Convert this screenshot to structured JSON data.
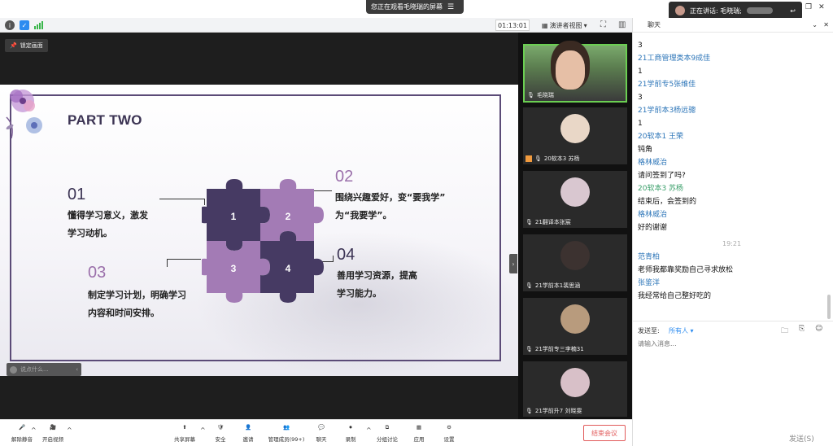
{
  "share_banner": {
    "text": "您正在观看毛晓瑞的屏幕"
  },
  "toolbar": {
    "timer": "01:13:01",
    "view_mode": "演讲者视图"
  },
  "share_area": {
    "lock_label": "锁定画面",
    "say_placeholder": "说点什么..."
  },
  "slide": {
    "title": "PART TWO",
    "items": [
      {
        "num": "01",
        "line1": "懂得学习意义，激发",
        "line2": "学习动机。"
      },
      {
        "num": "02",
        "line1": "围绕兴趣爱好，变“要我学”",
        "line2": "为“我要学”。"
      },
      {
        "num": "03",
        "line1": "制定学习计划，明确学习",
        "line2": "内容和时间安排。"
      },
      {
        "num": "04",
        "line1": "善用学习资源，提高",
        "line2": "学习能力。"
      }
    ],
    "puzzle_labels": [
      "1",
      "2",
      "3",
      "4"
    ],
    "colors": {
      "dark": "#463a63",
      "light": "#a37bb5",
      "frame": "#5b4b77"
    }
  },
  "video_tiles": [
    {
      "name": "毛晓瑞"
    },
    {
      "name": "20软本3 苏杨"
    },
    {
      "name": "21翻译本张宸"
    },
    {
      "name": "21学前本1裴思涵"
    },
    {
      "name": "21学前专三李楠31"
    },
    {
      "name": "21学前升7 刘晓雯"
    }
  ],
  "speaking": {
    "label": "正在讲话: 毛晓瑞;"
  },
  "chat": {
    "title": "聊天",
    "messages": [
      {
        "type": "body",
        "text": "3"
      },
      {
        "type": "sender",
        "text": "21工商管理类本9成佳"
      },
      {
        "type": "body",
        "text": "1"
      },
      {
        "type": "sender",
        "text": "21学前专5张维佳"
      },
      {
        "type": "body",
        "text": "3"
      },
      {
        "type": "sender",
        "text": "21学前本3杨远骢"
      },
      {
        "type": "body",
        "text": "1"
      },
      {
        "type": "sender",
        "text": "20软本1 王荣"
      },
      {
        "type": "body",
        "text": "钝角"
      },
      {
        "type": "sender",
        "text": "格林威治"
      },
      {
        "type": "body",
        "text": "请问签到了吗?"
      },
      {
        "type": "sender-green",
        "text": "20软本3  苏杨"
      },
      {
        "type": "body",
        "text": "结束后，会签到的"
      },
      {
        "type": "sender",
        "text": "格林威治"
      },
      {
        "type": "body",
        "text": "好的谢谢"
      },
      {
        "type": "time",
        "text": "19:21"
      },
      {
        "type": "sender",
        "text": "范青柏"
      },
      {
        "type": "body",
        "text": "老师我都靠奖励自己寻求放松"
      },
      {
        "type": "sender",
        "text": "张鉴洋"
      },
      {
        "type": "body",
        "text": "我经常给自己整好吃的"
      }
    ],
    "send_to_label": "发送至:",
    "send_to_value": "所有人",
    "input_placeholder": "请输入消息...",
    "send_button": "发送(S)"
  },
  "bottom_bar": {
    "mute": "解除静音",
    "video": "开启视频",
    "share": "共享屏幕",
    "security": "安全",
    "invite": "邀请",
    "members": "管理成员(99+)",
    "chat": "聊天",
    "record": "录制",
    "breakout": "分组讨论",
    "apps": "应用",
    "settings": "设置",
    "end": "结束会议"
  }
}
